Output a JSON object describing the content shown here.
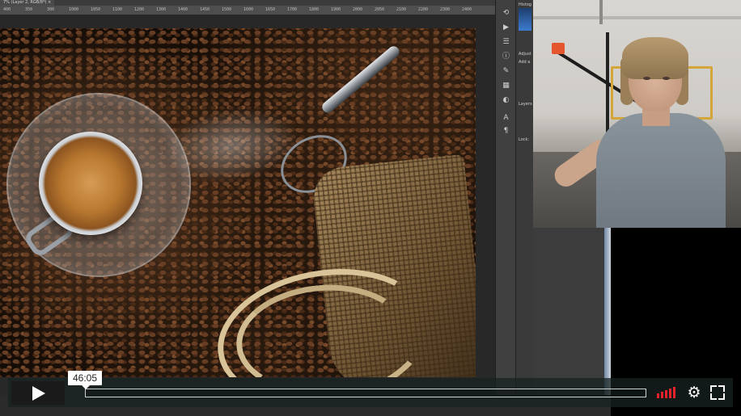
{
  "photoshop": {
    "doc_tab_label": "7% (Layer 2, RGB/8*) ×",
    "ruler_ticks": [
      "400",
      "350",
      "300",
      "1000",
      "1050",
      "1100",
      "1200",
      "1300",
      "1400",
      "1450",
      "1500",
      "1600",
      "1650",
      "1700",
      "1800",
      "1900",
      "2000",
      "2050",
      "2100",
      "2200",
      "2300",
      "2400"
    ],
    "panels": {
      "histogram_label": "Histog",
      "adjust_label": "Adjust",
      "add_label": "Add a",
      "layers_label": "Layers",
      "lock_label": "Lock:"
    }
  },
  "player": {
    "current_time": "46:05",
    "progress_fraction": 0,
    "volume_level": 5,
    "accent_color": "#e8222b",
    "icons": {
      "play": "play-icon",
      "volume": "volume-icon",
      "settings": "gear-icon",
      "fullscreen": "fullscreen-icon"
    }
  }
}
